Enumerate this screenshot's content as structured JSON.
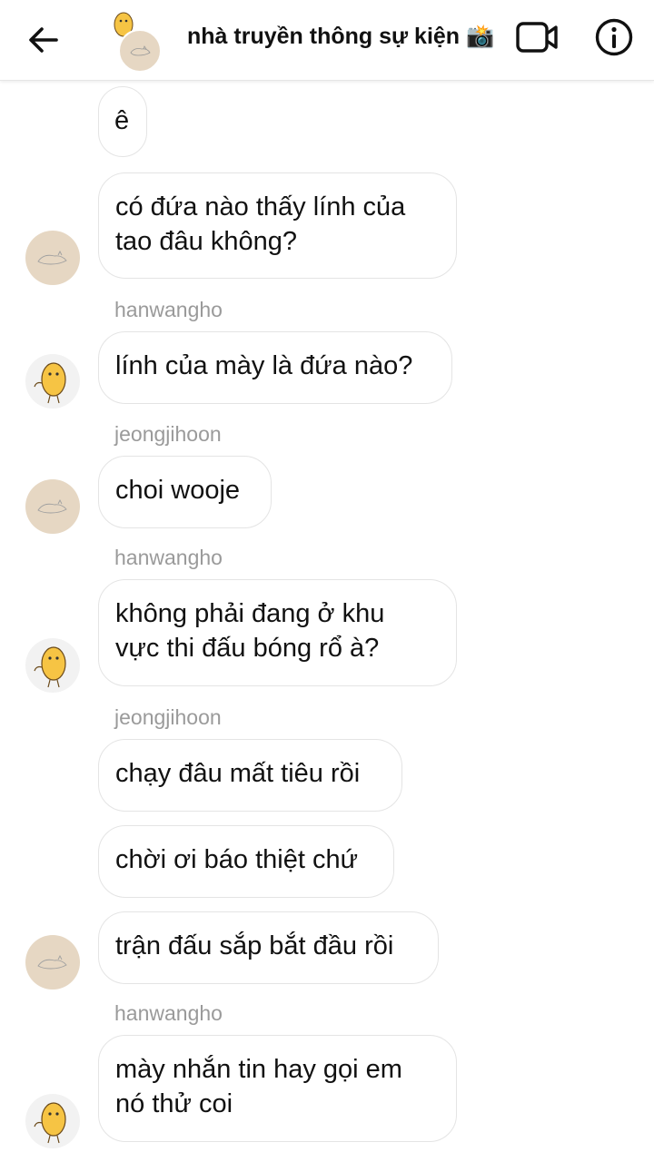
{
  "header": {
    "title": "nhà truyền thông sự kiện 📸",
    "back_icon": "arrow-left-icon",
    "video_icon": "video-camera-icon",
    "info_icon": "info-icon"
  },
  "messages": [
    {
      "text": "ê"
    },
    {
      "text": "có đứa nào thấy lính của\ntao đâu không?"
    },
    {
      "sender": "hanwangho",
      "text": "lính của mày là đứa nào?"
    },
    {
      "sender": "jeongjihoon",
      "text": "choi wooje"
    },
    {
      "sender": "hanwangho",
      "text": "không phải đang ở khu\nvực thi đấu bóng rổ à?"
    },
    {
      "sender": "jeongjihoon",
      "text": "chạy đâu mất tiêu rồi"
    },
    {
      "text": "chời ơi báo thiệt chứ"
    },
    {
      "text": "trận đấu sắp bắt đầu rồi"
    },
    {
      "sender": "hanwangho",
      "text": "mày nhắn tin hay gọi em\nnó thử coi"
    }
  ],
  "colors": {
    "cat_avatar_bg": "#e6d7c3",
    "potato_color": "#f6c444",
    "name_gray": "#9a9a9a",
    "bubble_border": "#e4e4e4"
  }
}
